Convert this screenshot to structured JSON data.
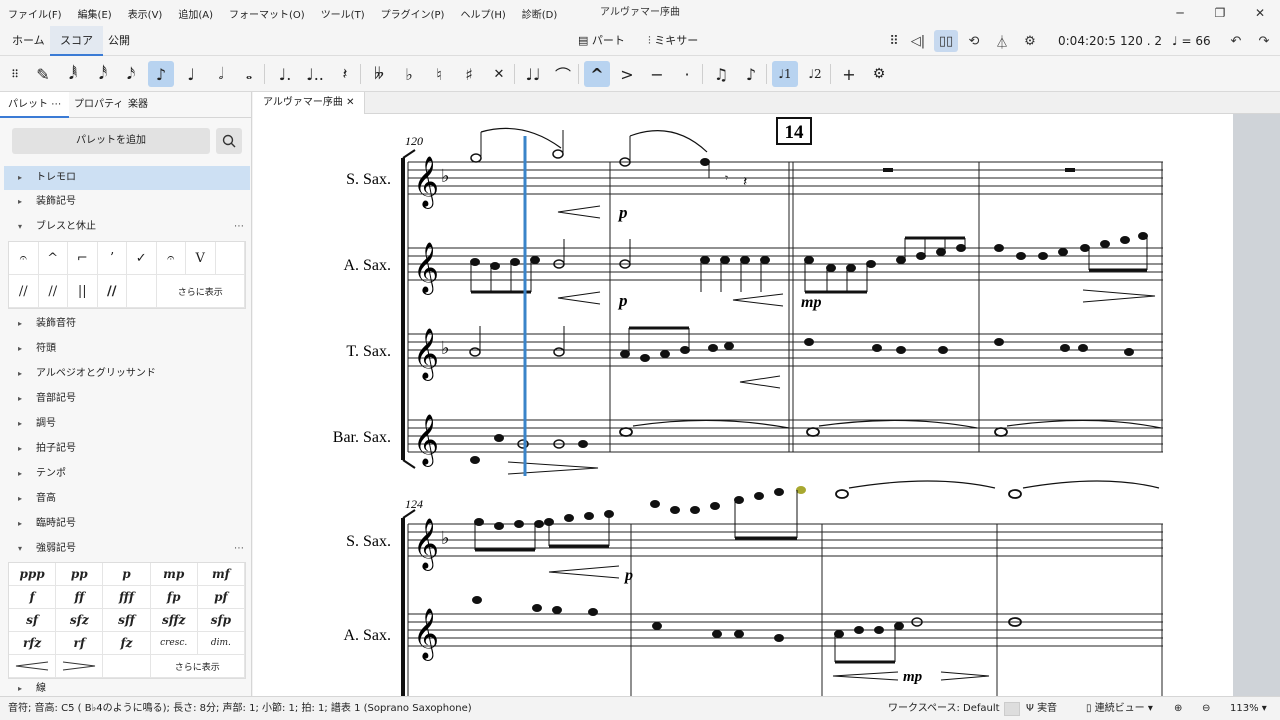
{
  "menu": [
    "ファイル(F)",
    "編集(E)",
    "表示(V)",
    "追加(A)",
    "フォーマット(O)",
    "ツール(T)",
    "プラグイン(P)",
    "ヘルプ(H)",
    "診断(D)"
  ],
  "window_title": "アルヴァマー序曲",
  "top_tabs": [
    "ホーム",
    "スコア",
    "公開"
  ],
  "toolbar": {
    "parts_label": "パート",
    "mixer_label": "ミキサー",
    "time": "0:04:20:5",
    "position": "120 . 2",
    "tempo": "= 66"
  },
  "panel": {
    "tabs": [
      "パレット",
      "プロパティ",
      "楽器"
    ],
    "add_palette": "パレットを追加",
    "items": [
      {
        "label": "トレモロ",
        "expanded": false
      },
      {
        "label": "装飾記号",
        "expanded": false
      },
      {
        "label": "ブレスと休止",
        "expanded": true
      },
      {
        "label": "装飾音符",
        "expanded": false
      },
      {
        "label": "符頭",
        "expanded": false
      },
      {
        "label": "アルペジオとグリッサンド",
        "expanded": false
      },
      {
        "label": "音部記号",
        "expanded": false
      },
      {
        "label": "調号",
        "expanded": false
      },
      {
        "label": "拍子記号",
        "expanded": false
      },
      {
        "label": "テンポ",
        "expanded": false
      },
      {
        "label": "音高",
        "expanded": false
      },
      {
        "label": "臨時記号",
        "expanded": false
      },
      {
        "label": "強弱記号",
        "expanded": true
      },
      {
        "label": "線",
        "expanded": false
      }
    ],
    "breath_cells": [
      "𝄐",
      "^",
      "⌐",
      "ʼ",
      "✓",
      "𝄐",
      "V",
      "//",
      "//",
      "||",
      "//"
    ],
    "more_label": "さらに表示",
    "dynamics_cells": [
      "ppp",
      "pp",
      "p",
      "mp",
      "mf",
      "f",
      "ff",
      "fff",
      "fp",
      "pf",
      "sf",
      "sfz",
      "sff",
      "sffz",
      "sfp",
      "rfz",
      "rf",
      "fz",
      "cresc.",
      "dim."
    ]
  },
  "document_tab": "アルヴァマー序曲",
  "score": {
    "instruments_top": [
      "S. Sax.",
      "A. Sax.",
      "T. Sax.",
      "Bar. Sax."
    ],
    "instruments_bottom": [
      "S. Sax.",
      "A. Sax."
    ],
    "measure_start_top": "120",
    "measure_start_bottom": "124",
    "rehearsal_mark": "14",
    "dynamics": [
      "p",
      "p",
      "mp",
      "p",
      "mp"
    ]
  },
  "status": {
    "text": "音符; 音高: C5 ( B♭4のように鳴る); 長さ: 8分; 声部: 1; 小節: 1; 拍: 1; 譜表 1 (Soprano Saxophone)",
    "workspace": "ワークスペース: Default",
    "concert_pitch": "実音",
    "view_mode": "連続ビュー",
    "zoom": "113%"
  }
}
